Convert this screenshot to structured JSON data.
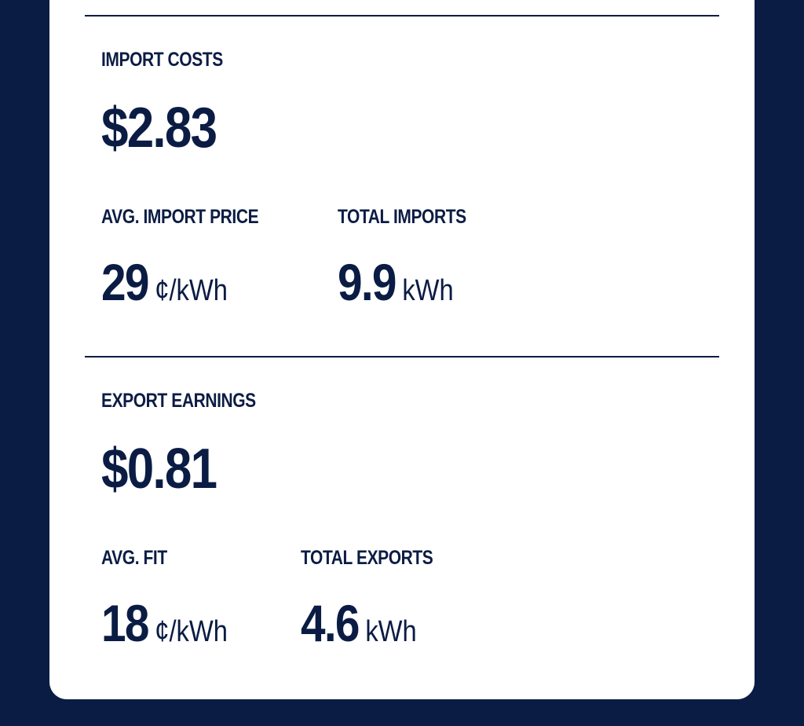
{
  "imports": {
    "title": "IMPORT COSTS",
    "amount": "$2.83",
    "avg_price": {
      "label": "AVG. IMPORT PRICE",
      "value": "29",
      "unit": "¢/kWh"
    },
    "total": {
      "label": "TOTAL IMPORTS",
      "value": "9.9",
      "unit": "kWh"
    }
  },
  "exports": {
    "title": "EXPORT EARNINGS",
    "amount": "$0.81",
    "avg_fit": {
      "label": "AVG. FIT",
      "value": "18",
      "unit": "¢/kWh"
    },
    "total": {
      "label": "TOTAL EXPORTS",
      "value": "4.6",
      "unit": "kWh"
    }
  },
  "colors": {
    "background": "#0b1c44",
    "card": "#ffffff",
    "text": "#0b1c44"
  }
}
